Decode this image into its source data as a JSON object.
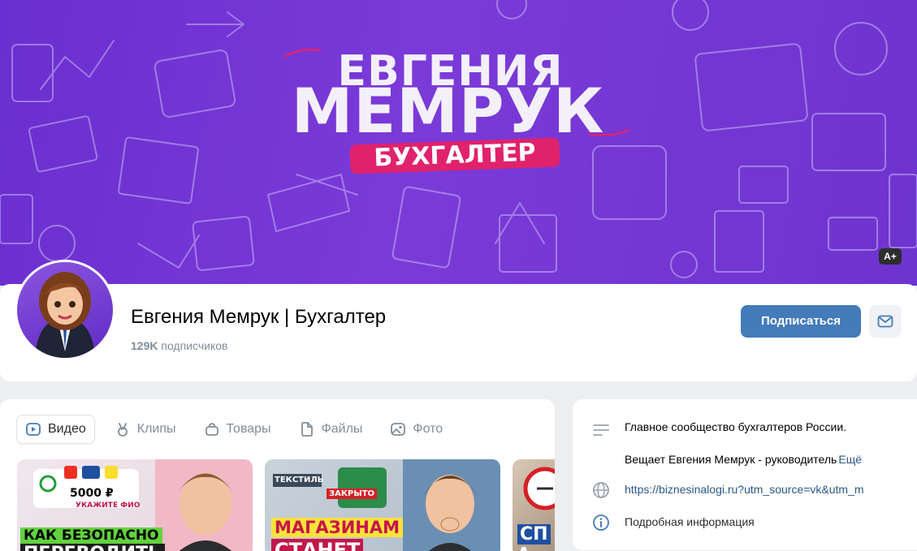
{
  "cover": {
    "line1": "ЕВГЕНИЯ",
    "line2": "МЕМРУК",
    "badge": "БУХГАЛТЕР",
    "corner_badge": "A+"
  },
  "profile": {
    "name": "Евгения Мемрук | Бухгалтер",
    "subscribers_count": "129K",
    "subscribers_label": " подписчиков",
    "subscribe_label": "Подписаться",
    "message_icon": "mail-icon"
  },
  "tabs": [
    {
      "label": "Видео",
      "icon": "video-icon",
      "active": true
    },
    {
      "label": "Клипы",
      "icon": "clips-icon",
      "active": false
    },
    {
      "label": "Товары",
      "icon": "bag-icon",
      "active": false
    },
    {
      "label": "Файлы",
      "icon": "file-icon",
      "active": false
    },
    {
      "label": "Фото",
      "icon": "photo-icon",
      "active": false
    }
  ],
  "videos": [
    {
      "caption_top": "5000 ₽",
      "caption_sub": "УКАЖИТЕ ФИО",
      "caption_main": "КАК БЕЗОПАСНО",
      "caption_next": "ПЕРЕВОДИТЬ"
    },
    {
      "caption_top": "ТЕКСТИЛЬ",
      "caption_sub": "ЗАКРЫТО",
      "caption_main": "МАГАЗИНАМ",
      "caption_next": "СТАНЕТ"
    },
    {
      "caption_main": "СП",
      "caption_next": "А"
    }
  ],
  "info": {
    "description_line1": "Главное сообщество бухгалтеров России.",
    "description_line2": "Вещает Евгения Мемрук - руководитель",
    "more_label": "Ещё",
    "website": "https://biznesinalogi.ru?utm_source=vk&utm_m",
    "details_label": "Подробная информация"
  },
  "colors": {
    "accent": "#447bba",
    "cover_purple": "#6e34cf",
    "badge_pink": "#e0226c",
    "link": "#2a5885"
  }
}
